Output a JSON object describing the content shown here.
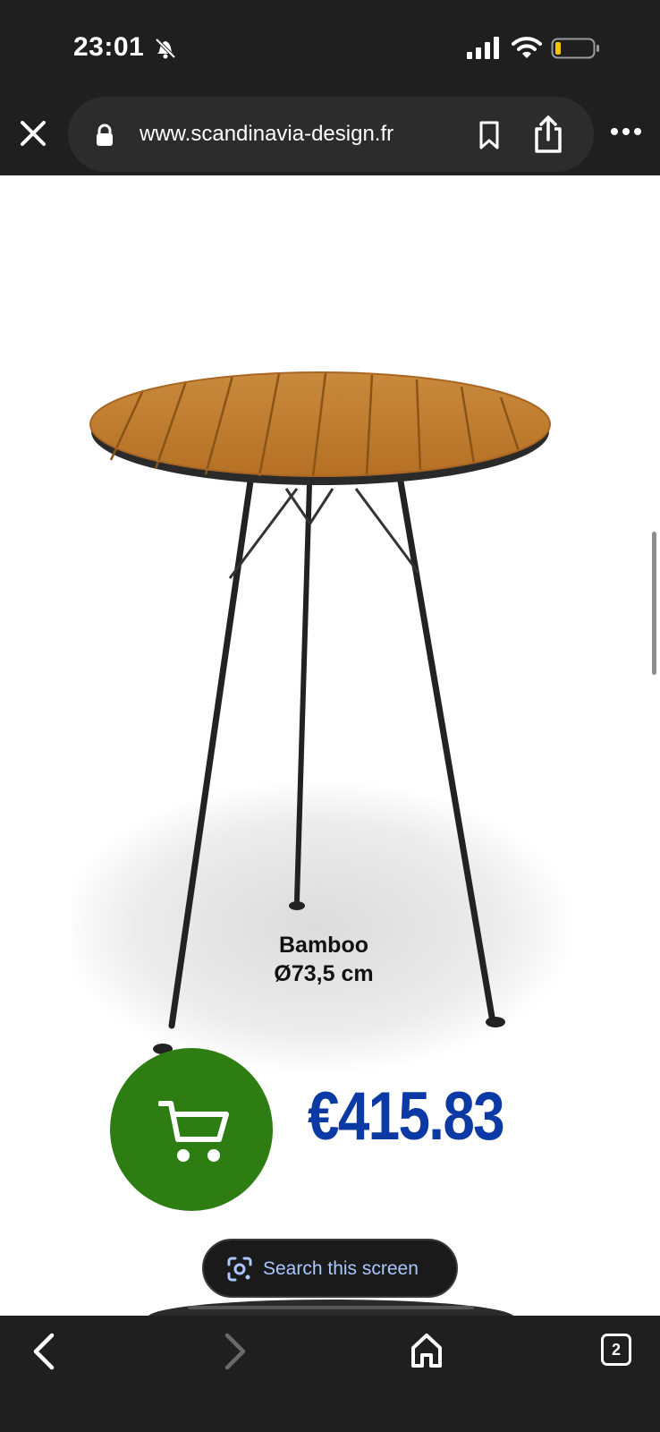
{
  "status": {
    "time": "23:01"
  },
  "browser": {
    "url": "www.scandinavia-design.fr"
  },
  "product": {
    "name": "Bamboo",
    "size": "Ø73,5 cm",
    "price": "€415.83"
  },
  "overlay": {
    "search_label": "Search this screen"
  },
  "toolbar": {
    "tab_count": "2"
  },
  "colors": {
    "price": "#0b3aa4",
    "cart_button": "#2e7d12",
    "chrome": "#1f1f1f"
  }
}
